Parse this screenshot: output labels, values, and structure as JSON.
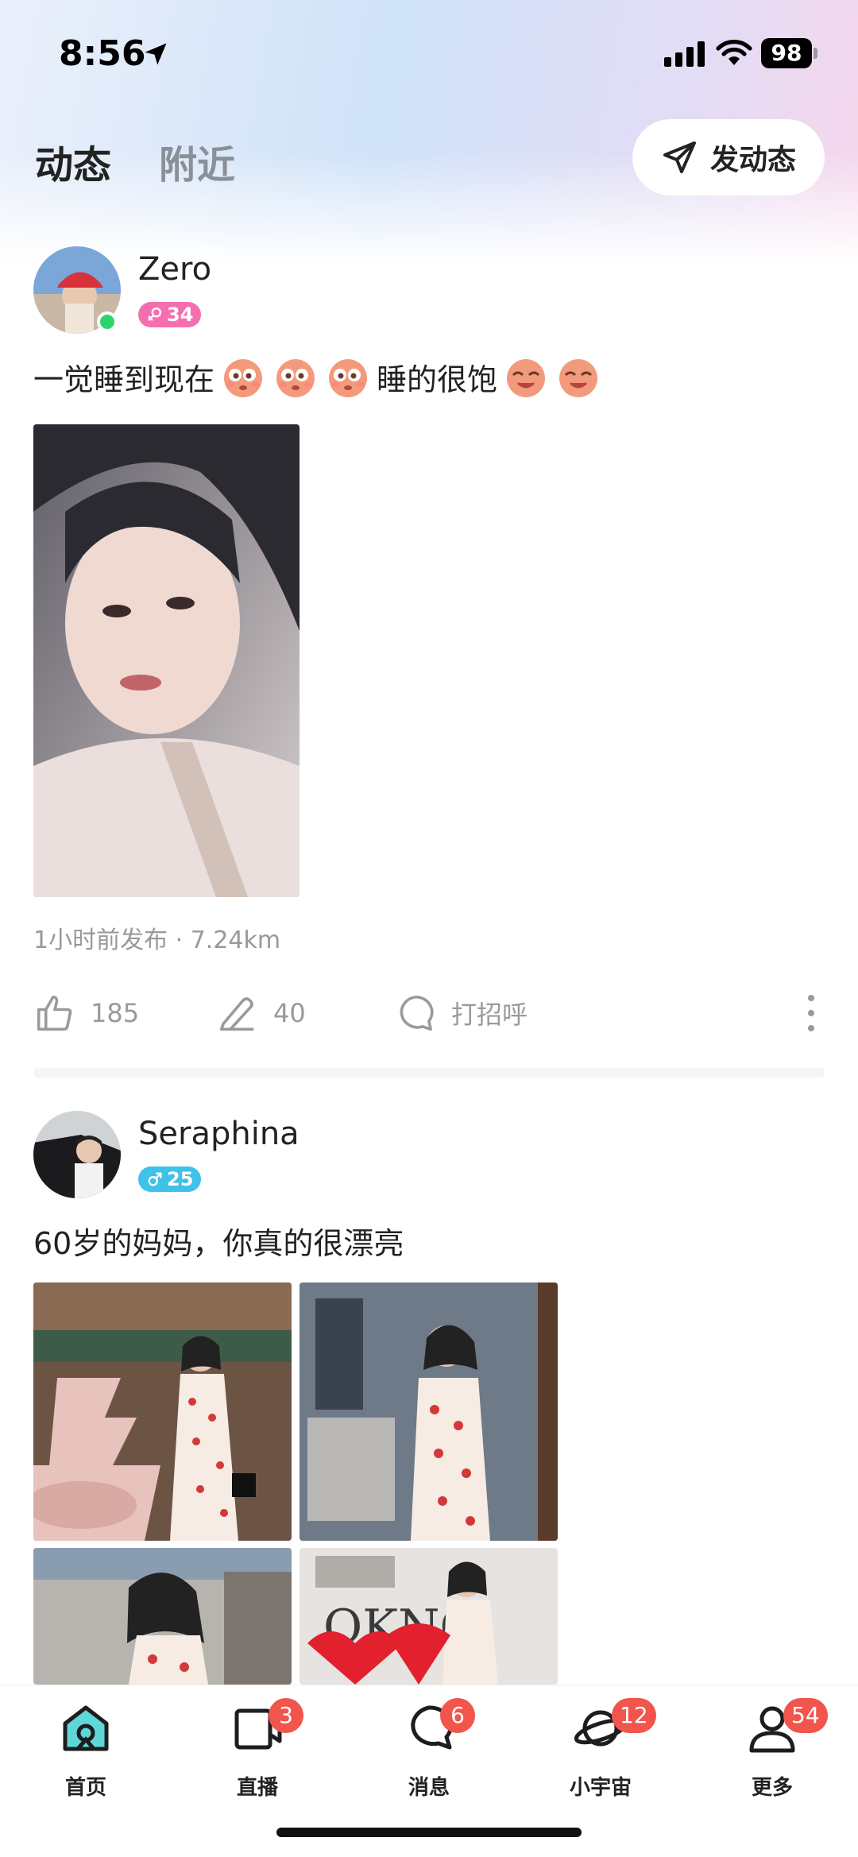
{
  "status_bar": {
    "time": "8:56",
    "battery": "98"
  },
  "header": {
    "tabs": [
      {
        "label": "动态",
        "active": true
      },
      {
        "label": "附近",
        "active": false
      }
    ],
    "post_button": "发动态"
  },
  "posts": [
    {
      "username": "Zero",
      "gender": "female",
      "age": "34",
      "online": true,
      "text_before": "一觉睡到现在",
      "text_after": "睡的很饱",
      "meta": "1小时前发布 · 7.24km",
      "likes": "185",
      "comments": "40",
      "greet": "打招呼"
    },
    {
      "username": "Seraphina",
      "gender": "male",
      "age": "25",
      "text": "60岁的妈妈，你真的很漂亮"
    }
  ],
  "bottom_nav": [
    {
      "label": "首页",
      "icon": "home-icon",
      "badge": ""
    },
    {
      "label": "直播",
      "icon": "live-icon",
      "badge": "3"
    },
    {
      "label": "消息",
      "icon": "message-icon",
      "badge": "6"
    },
    {
      "label": "小宇宙",
      "icon": "planet-icon",
      "badge": "12"
    },
    {
      "label": "更多",
      "icon": "profile-icon",
      "badge": "54"
    }
  ],
  "colors": {
    "female_badge": "#f56fb0",
    "male_badge": "#3fc1ea",
    "nav_badge": "#f2554b",
    "online": "#2fd36b",
    "home_accent": "#5fd6d8"
  }
}
